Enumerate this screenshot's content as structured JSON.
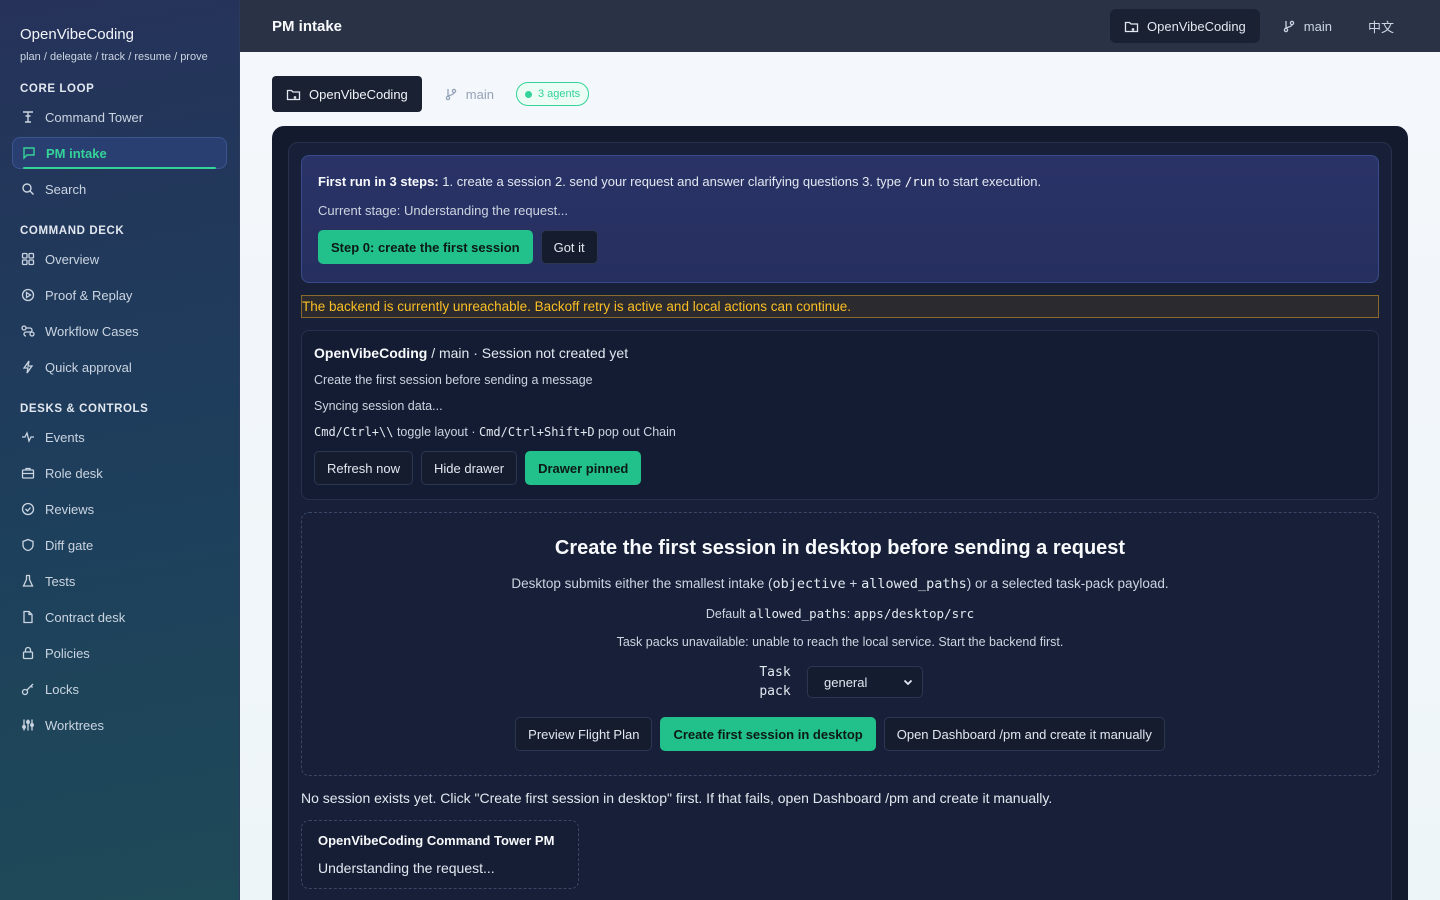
{
  "sidebar": {
    "brand_title": "OpenVibeCoding",
    "brand_sub": "plan / delegate / track / resume / prove",
    "sections": [
      {
        "title": "CORE LOOP"
      },
      {
        "title": "COMMAND DECK"
      },
      {
        "title": "DESKS & CONTROLS"
      }
    ],
    "items": {
      "command_tower": "Command Tower",
      "pm_intake": "PM intake",
      "search": "Search",
      "overview": "Overview",
      "proof_replay": "Proof & Replay",
      "workflow_cases": "Workflow Cases",
      "quick_approval": "Quick approval",
      "events": "Events",
      "role_desk": "Role desk",
      "reviews": "Reviews",
      "diff_gate": "Diff gate",
      "tests": "Tests",
      "contract_desk": "Contract desk",
      "policies": "Policies",
      "locks": "Locks",
      "worktrees": "Worktrees"
    }
  },
  "topbar": {
    "title": "PM intake",
    "repo": "OpenVibeCoding",
    "branch": "main",
    "language": "中文"
  },
  "context": {
    "repo": "OpenVibeCoding",
    "branch": "main",
    "agents": "3 agents"
  },
  "onboarding": {
    "bold": "First run in 3 steps:",
    "text_a": " 1. create a session 2. send your request and answer clarifying questions 3. type ",
    "code": "/run",
    "text_b": " to start execution.",
    "stage": "Current stage: Understanding the request...",
    "primary": "Step 0: create the first session",
    "dismiss": "Got it"
  },
  "warning": "The backend is currently unreachable. Backoff retry is active and local actions can continue.",
  "session": {
    "repo": "OpenVibeCoding",
    "rest": " / main · Session not created yet",
    "hint": "Create the first session before sending a message",
    "sync": "Syncing session data...",
    "kb1": "Cmd/Ctrl+\\\\",
    "kb1_text": " toggle layout · ",
    "kb2": "Cmd/Ctrl+Shift+D",
    "kb2_text": " pop out Chain",
    "refresh": "Refresh now",
    "hide": "Hide drawer",
    "pinned": "Drawer pinned"
  },
  "create": {
    "title": "Create the first session in desktop before sending a request",
    "desc_a": "Desktop submits either the smallest intake (",
    "desc_code1": "objective",
    "desc_plus": " + ",
    "desc_code2": "allowed_paths",
    "desc_b": ") or a selected task-pack payload.",
    "default_label": "Default ",
    "default_key": "allowed_paths",
    "default_colon": ": ",
    "default_val": "apps/desktop/src",
    "unavailable": "Task packs unavailable: unable to reach the local service. Start the backend first.",
    "pack_label_1": "Task",
    "pack_label_2": "pack",
    "pack_value": "general",
    "preview": "Preview Flight Plan",
    "create_btn": "Create first session in desktop",
    "open_dash": "Open Dashboard /pm and create it manually"
  },
  "no_session": "No session exists yet. Click \"Create first session in desktop\" first. If that fails, open Dashboard /pm and create it manually.",
  "chat": {
    "title": "OpenVibeCoding Command Tower PM",
    "status": "Understanding the request..."
  },
  "colors": {
    "accent": "#34d399",
    "sidebar_bg": "#26325a",
    "panel_bg": "#131a2e",
    "warning": "#fbbf24"
  }
}
